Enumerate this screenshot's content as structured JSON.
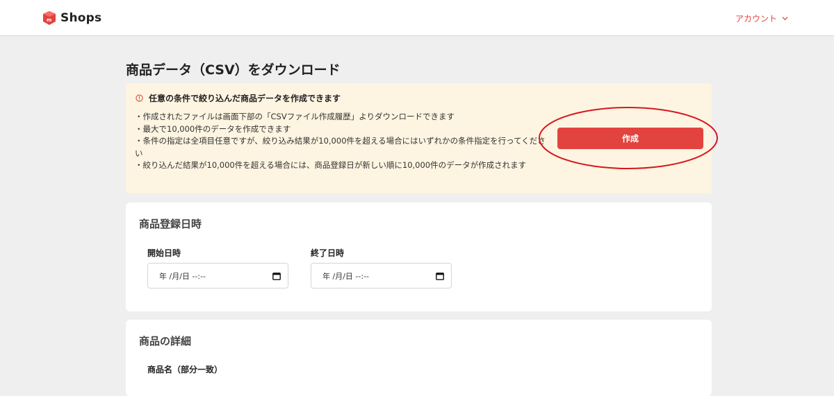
{
  "header": {
    "logo_text": "Shops",
    "account_label": "アカウント",
    "brand_color": "#e2433f",
    "icons": {
      "logo": "mercari-logo-icon",
      "account_chevron": "chevron-down-icon"
    }
  },
  "page": {
    "title": "商品データ（CSV）をダウンロード"
  },
  "notice": {
    "heading": "任意の条件で絞り込んだ商品データを作成できます",
    "items": [
      "・作成されたファイルは画面下部の「CSVファイル作成履歴」よりダウンロードできます",
      "・最大で10,000件のデータを作成できます",
      "・条件の指定は全項目任意ですが、絞り込み結果が10,000件を超える場合にはいずれかの条件指定を行ってください",
      "・絞り込んだ結果が10,000件を超える場合には、商品登録日が新しい順に10,000件のデータが作成されます"
    ],
    "create_button_label": "作成",
    "icon": "info-icon"
  },
  "registration": {
    "title": "商品登録日時",
    "start_label": "開始日時",
    "start_value": "年 /月/日 --:--",
    "end_label": "終了日時",
    "end_value": "年 /月/日 --:--",
    "icon": "calendar-icon"
  },
  "details": {
    "title": "商品の詳細",
    "name_label": "商品名（部分一致）"
  }
}
